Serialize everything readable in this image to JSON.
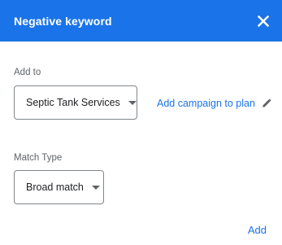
{
  "dialog": {
    "title": "Negative keyword",
    "header_color": "#1a73e8",
    "close_icon": "close-icon"
  },
  "add_to": {
    "label": "Add to",
    "selected": "Septic Tank Services",
    "link_label": "Add campaign to plan",
    "link_icon": "pencil-icon"
  },
  "match_type": {
    "label": "Match Type",
    "selected": "Broad match"
  },
  "actions": {
    "add_label": "Add"
  }
}
